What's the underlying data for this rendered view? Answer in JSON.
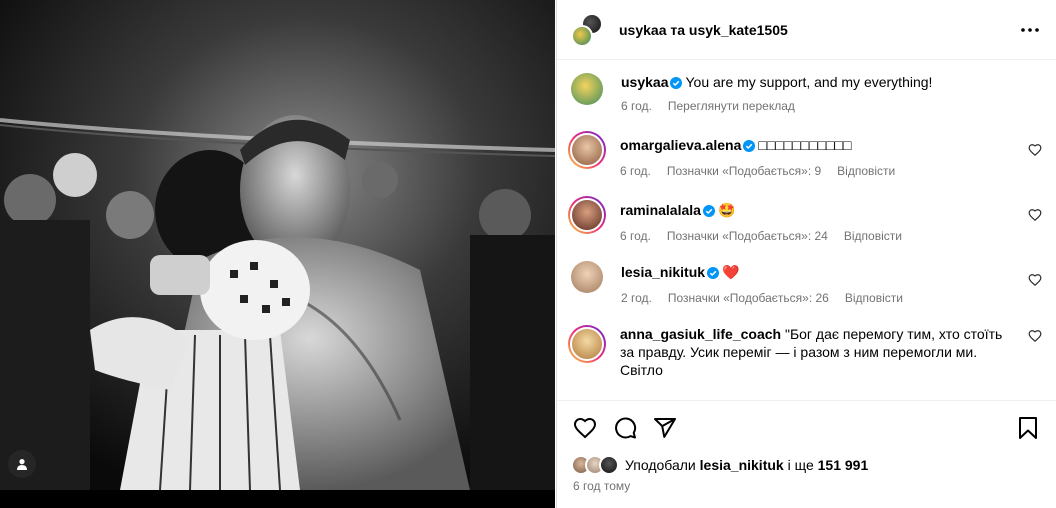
{
  "post": {
    "header_title": "usykaa та usyk_kate1505",
    "caption": {
      "username": "usykaa",
      "text": "You are my support, and my everything!",
      "time": "6 год.",
      "translate": "Переглянути переклад"
    }
  },
  "comments": [
    {
      "username": "omargalieva.alena",
      "text": "□□□□□□□□□□□",
      "time": "6 год.",
      "likes": "Позначки «Подобається»: 9",
      "reply": "Відповісти",
      "avatar_color": "#c68a6a"
    },
    {
      "username": "raminalalala",
      "text": "🤩",
      "time": "6 год.",
      "likes": "Позначки «Подобається»: 24",
      "reply": "Відповісти",
      "avatar_color": "#8a4a3a"
    },
    {
      "username": "lesia_nikituk",
      "text": "❤️",
      "time": "2 год.",
      "likes": "Позначки «Подобається»: 26",
      "reply": "Відповісти",
      "avatar_color": "#d9b79b"
    },
    {
      "username": "anna_gasiuk_life_coach",
      "text": "\"Бог дає перемогу тим, хто стоїть за правду. Усик переміг — і разом з ним перемогли ми. Світло",
      "avatar_color": "#e0b36a"
    }
  ],
  "likes_bar": {
    "prefix": "Уподобали",
    "user": "lesia_nikituk",
    "middle": "і ще",
    "count": "151 991"
  },
  "posted_time": "6 год тому",
  "icons": [
    "user-tag-icon",
    "more-icon",
    "verified-icon",
    "heart-icon",
    "comment-icon",
    "share-icon",
    "save-icon"
  ],
  "colors": {
    "verified": "#0095f6",
    "secondary_text": "#737373",
    "heart_red": "#ff3040"
  }
}
